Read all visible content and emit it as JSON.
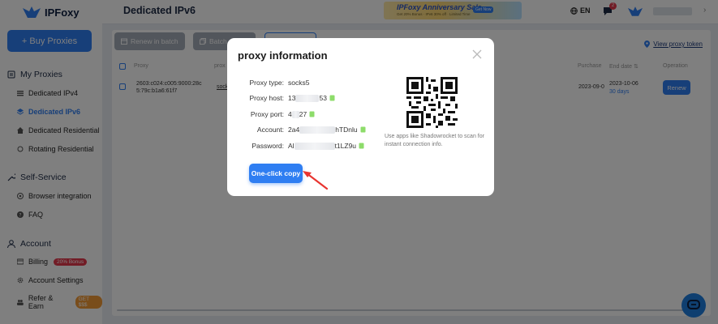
{
  "brand": {
    "name": "IPFoxy",
    "primary": "#2f7ef2",
    "danger": "#e5394d"
  },
  "sidebar": {
    "buy_button": "+ Buy Proxies",
    "my_proxies": {
      "title": "My Proxies",
      "items": [
        {
          "label": "Dedicated IPv4",
          "icon": "list-icon"
        },
        {
          "label": "Dedicated IPv6",
          "icon": "layers-icon",
          "active": true
        },
        {
          "label": "Dedicated Residential",
          "icon": "home-icon"
        },
        {
          "label": "Rotating Residential",
          "icon": "rotate-icon"
        }
      ]
    },
    "self_service": {
      "title": "Self-Service",
      "items": [
        {
          "label": "Browser integration",
          "icon": "browser-icon"
        },
        {
          "label": "FAQ",
          "icon": "question-icon"
        }
      ]
    },
    "account": {
      "title": "Account",
      "items": [
        {
          "label": "Billing",
          "badge": "20% Bonus",
          "icon": "card-icon"
        },
        {
          "label": "Account Settings",
          "icon": "gear-icon"
        },
        {
          "label": "Refer & Earn",
          "badge": "GET $$$",
          "icon": "people-icon"
        }
      ]
    }
  },
  "header": {
    "title": "Dedicated IPv6",
    "banner": {
      "title": "IPFoxy Anniversary Sale",
      "subtitle": "Get 20% Bonus · IPv6 30% off · Limited Time",
      "pill": "Get Now"
    },
    "lang": "EN",
    "notifications": "2"
  },
  "toolbar": {
    "renew_batch": "Renew in batch",
    "batch": "Batch",
    "view_token": "View proxy token"
  },
  "table": {
    "headers": {
      "proxy": "Proxy",
      "proxy2": "prox",
      "purchase": "Purchase",
      "end_date": "End date",
      "operation": "Operation"
    },
    "row": {
      "proxy_line1": "2603:c024:c005:9000:28c",
      "proxy_line2": "5:79c:b1a6:61f7",
      "proxy2": "sock",
      "purchase": "2023-09-0",
      "end_date": "2023-10-06",
      "days": "30 days",
      "renew": "Renew"
    }
  },
  "modal": {
    "title": "proxy information",
    "fields": [
      {
        "label": "Proxy type:",
        "prefix": "socks5",
        "suffix": "",
        "hidden": false,
        "copy": false
      },
      {
        "label": "Proxy host:",
        "prefix": "13",
        "suffix": "53",
        "hidden": true,
        "copy": true
      },
      {
        "label": "Proxy port:",
        "prefix": "4",
        "suffix": "27",
        "hidden": true,
        "copy": true
      },
      {
        "label": "Account:",
        "prefix": "2a4",
        "suffix": "hTDnlu",
        "hidden": true,
        "copy": true
      },
      {
        "label": "Password:",
        "prefix": "Al",
        "suffix": "t1LZ9u",
        "hidden": true,
        "copy": true
      }
    ],
    "qr_hint": "Use apps like Shadowrocket to scan for instant connection info.",
    "copy_button": "One-click copy"
  }
}
